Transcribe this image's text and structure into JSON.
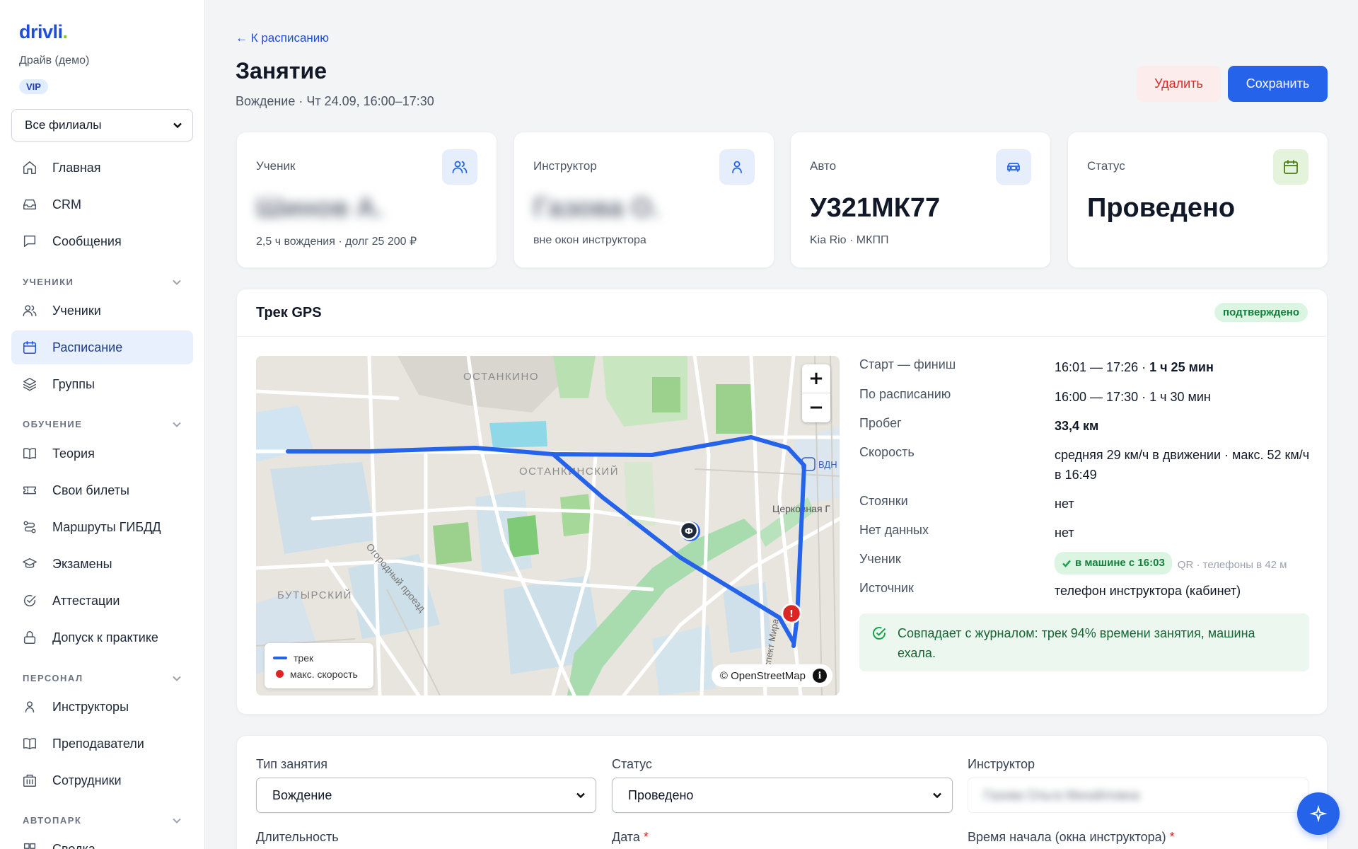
{
  "sidebar": {
    "logo": "drivli",
    "logo_dot": ".",
    "school": "Драйв (демо)",
    "plan_badge": "VIP",
    "branch_select": "Все филиалы",
    "items_top": [
      {
        "label": "Главная",
        "icon": "home-icon"
      },
      {
        "label": "CRM",
        "icon": "inbox-icon"
      },
      {
        "label": "Сообщения",
        "icon": "chat-icon"
      }
    ],
    "sections": {
      "students": "УЧЕНИКИ",
      "education": "ОБУЧЕНИЕ",
      "staff": "ПЕРСОНАЛ",
      "fleet": "АВТОПАРК"
    },
    "items_students": [
      {
        "label": "Ученики",
        "icon": "users-icon"
      },
      {
        "label": "Расписание",
        "icon": "calendar-icon",
        "active": true
      },
      {
        "label": "Группы",
        "icon": "layers-icon"
      }
    ],
    "items_education": [
      {
        "label": "Теория",
        "icon": "book-icon"
      },
      {
        "label": "Свои билеты",
        "icon": "ticket-icon"
      },
      {
        "label": "Маршруты ГИБДД",
        "icon": "route-icon"
      },
      {
        "label": "Экзамены",
        "icon": "graduation-cap-icon"
      },
      {
        "label": "Аттестации",
        "icon": "check-circle-icon"
      },
      {
        "label": "Допуск к практике",
        "icon": "lock-icon"
      }
    ],
    "items_staff": [
      {
        "label": "Инструкторы",
        "icon": "user-icon"
      },
      {
        "label": "Преподаватели",
        "icon": "book-open-icon"
      },
      {
        "label": "Сотрудники",
        "icon": "building-icon"
      }
    ],
    "items_fleet": [
      {
        "label": "Сводка",
        "icon": "grid-icon"
      }
    ]
  },
  "header": {
    "back_link": "← К расписанию",
    "title": "Занятие",
    "subtitle": "Вождение · Чт 24.09, 16:00–17:30",
    "delete_label": "Удалить",
    "save_label": "Сохранить"
  },
  "cards": {
    "student": {
      "label": "Ученик",
      "value": "Шинов А.",
      "sub": "2,5 ч вождения · долг 25 200 ₽"
    },
    "instructor": {
      "label": "Инструктор",
      "value": "Газова О.",
      "sub": "вне окон инструктора"
    },
    "car": {
      "label": "Авто",
      "value": "У321МК77",
      "sub": "Kia Rio · МКПП"
    },
    "status": {
      "label": "Статус",
      "value": "Проведено"
    }
  },
  "gps": {
    "title": "Трек GPS",
    "badge": "подтверждено",
    "map": {
      "labels": {
        "ostankino": "ОСТАНКИНО",
        "ostankinsky": "ОСТАНКИНСКИЙ",
        "butyrsky": "БУТЫРСКИЙ",
        "ogorodny": "Огородный проезд",
        "church": "Церковная Г",
        "vdnh": "ВДН",
        "prospekt": "спект Мира"
      },
      "zoom_in": "+",
      "zoom_out": "−",
      "legend_track": "трек",
      "legend_max_speed": "макс. скорость",
      "attribution": "© OpenStreetMap",
      "info": "i",
      "start_marker": "Ф",
      "max_marker": "!",
      "track_color": "#2563eb",
      "max_color": "#dc2626"
    },
    "rows": [
      {
        "key": "Старт — финиш",
        "value": "16:01 — 17:26 · ",
        "bold": "1 ч 25 мин"
      },
      {
        "key": "По расписанию",
        "value": "16:00 — 17:30 · 1 ч 30 мин"
      },
      {
        "key": "Пробег",
        "bold": "33,4 км"
      },
      {
        "key": "Скорость",
        "value": "средняя 29 км/ч в движении · макс. 52 км/ч в 16:49"
      },
      {
        "key": "Стоянки",
        "value": "нет"
      },
      {
        "key": "Нет данных",
        "value": "нет"
      },
      {
        "key": "Ученик",
        "chip": "в машине с 16:03",
        "note": "QR · телефоны в 42 м"
      },
      {
        "key": "Источник",
        "value": "телефон инструктора (кабинет)"
      }
    ],
    "match_text": "Совпадает с журналом: трек 94% времени занятия, машина ехала."
  },
  "form": {
    "type_label": "Тип занятия",
    "type_value": "Вождение",
    "status_label": "Статус",
    "status_value": "Проведено",
    "instructor_label": "Инструктор",
    "instructor_value": "Газова Ольга Михайловна",
    "duration_label": "Длительность",
    "date_label": "Дата",
    "start_label": "Время начала (окна инструктора)",
    "required_mark": "*"
  }
}
